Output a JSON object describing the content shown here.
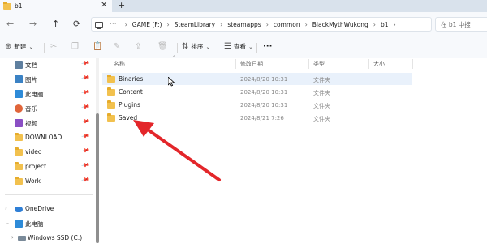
{
  "tab": {
    "title": "b1",
    "close": "✕",
    "new": "+"
  },
  "nav": {
    "back": "←",
    "forward": "→",
    "up": "↑",
    "refresh": "⟳"
  },
  "address": {
    "ellipsis": "···",
    "separator": "›",
    "crumbs": [
      "GAME (F:)",
      "SteamLibrary",
      "steamapps",
      "common",
      "BlackMythWukong",
      "b1"
    ]
  },
  "search": {
    "placeholder": "在 b1 中搜"
  },
  "commands": {
    "new_label": "新建",
    "sort_label": "排序",
    "view_label": "查看",
    "more_label": "···"
  },
  "sidebar": {
    "items": [
      {
        "label": "文档",
        "icon": "document-icon"
      },
      {
        "label": "图片",
        "icon": "pictures-icon"
      },
      {
        "label": "此电脑",
        "icon": "this-pc-icon"
      },
      {
        "label": "音乐",
        "icon": "music-icon"
      },
      {
        "label": "视频",
        "icon": "video-icon"
      },
      {
        "label": "DOWNLOAD",
        "icon": "folder-icon"
      },
      {
        "label": "video",
        "icon": "folder-icon"
      },
      {
        "label": "project",
        "icon": "folder-icon"
      },
      {
        "label": "Work",
        "icon": "folder-icon"
      }
    ],
    "onedrive": "OneDrive",
    "thispc": "此电脑",
    "drive": "Windows SSD (C:)"
  },
  "columns": {
    "name": "名称",
    "modified": "修改日期",
    "type": "类型",
    "size": "大小"
  },
  "files": [
    {
      "name": "Binaries",
      "modified": "2024/8/20 10:31",
      "type": "文件夹"
    },
    {
      "name": "Content",
      "modified": "2024/8/20 10:31",
      "type": "文件夹"
    },
    {
      "name": "Plugins",
      "modified": "2024/8/20 10:31",
      "type": "文件夹"
    },
    {
      "name": "Saved",
      "modified": "2024/8/21 7:26",
      "type": "文件夹"
    }
  ],
  "colors": {
    "accent": "#0a64c8",
    "arrow": "#e3262a",
    "folder": "#f2c14e",
    "hover_row": "#e9f1fb"
  }
}
